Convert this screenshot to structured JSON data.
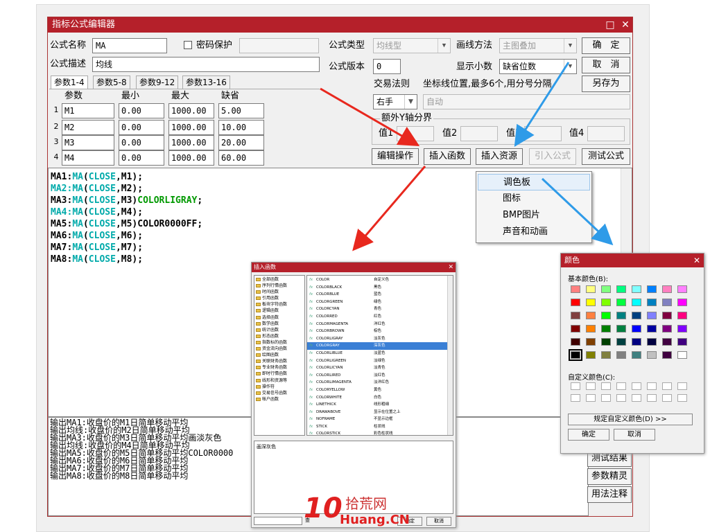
{
  "window": {
    "title": "指标公式编辑器",
    "restore_glyph": "□",
    "close_glyph": "✕"
  },
  "form": {
    "name_label": "公式名称",
    "name_value": "MA",
    "password_label": "密码保护",
    "desc_label": "公式描述",
    "desc_value": "均线",
    "type_label": "公式类型",
    "type_value": "均线型",
    "draw_label": "画线方法",
    "draw_value": "主图叠加",
    "version_label": "公式版本",
    "version_value": "0",
    "decimal_label": "显示小数",
    "decimal_value": "缺省位数",
    "trade_label": "交易法则",
    "trade_value": "右手",
    "coord_label": "坐标线位置,最多6个,用分号分隔",
    "coord_value": "自动",
    "extra_y_label": "额外Y轴分界",
    "values": [
      "值1",
      "值2",
      "值3",
      "值4"
    ]
  },
  "buttons": {
    "ok": "确　定",
    "cancel": "取　消",
    "save_as": "另存为",
    "edit": "编辑操作",
    "insert_func": "插入函数",
    "insert_res": "插入资源",
    "import": "引入公式",
    "test": "测试公式",
    "test_result": "测试结果",
    "param_wizard": "参数精灵",
    "usage_note": "用法注释"
  },
  "tabs": [
    "参数1-4",
    "参数5-8",
    "参数9-12",
    "参数13-16"
  ],
  "params": {
    "headers": [
      "参数",
      "最小",
      "最大",
      "缺省"
    ],
    "rows": [
      {
        "no": "1",
        "name": "M1",
        "min": "0.00",
        "max": "1000.00",
        "def": "5.00"
      },
      {
        "no": "2",
        "name": "M2",
        "min": "0.00",
        "max": "1000.00",
        "def": "10.00"
      },
      {
        "no": "3",
        "name": "M3",
        "min": "0.00",
        "max": "1000.00",
        "def": "20.00"
      },
      {
        "no": "4",
        "name": "M4",
        "min": "0.00",
        "max": "1000.00",
        "def": "60.00"
      }
    ]
  },
  "code_lines": [
    [
      {
        "t": "MA1:",
        "c": "black"
      },
      {
        "t": "MA",
        "c": "cyan"
      },
      {
        "t": "(",
        "c": "black"
      },
      {
        "t": "CLOSE",
        "c": "cyan"
      },
      {
        "t": ",M1);",
        "c": "black"
      }
    ],
    [
      {
        "t": "MA2:",
        "c": "cyan"
      },
      {
        "t": "MA",
        "c": "cyan"
      },
      {
        "t": "(",
        "c": "black"
      },
      {
        "t": "CLOSE",
        "c": "cyan"
      },
      {
        "t": ",M2);",
        "c": "black"
      }
    ],
    [
      {
        "t": "MA3:",
        "c": "black"
      },
      {
        "t": "MA",
        "c": "cyan"
      },
      {
        "t": "(",
        "c": "black"
      },
      {
        "t": "CLOSE",
        "c": "cyan"
      },
      {
        "t": ",M3)",
        "c": "black"
      },
      {
        "t": "COLORLIGRAY",
        "c": "green"
      },
      {
        "t": ";",
        "c": "black"
      }
    ],
    [
      {
        "t": "MA4:",
        "c": "cyan"
      },
      {
        "t": "MA",
        "c": "cyan"
      },
      {
        "t": "(",
        "c": "black"
      },
      {
        "t": "CLOSE",
        "c": "cyan"
      },
      {
        "t": ",M4);",
        "c": "black"
      }
    ],
    [
      {
        "t": "MA5:",
        "c": "black"
      },
      {
        "t": "MA",
        "c": "cyan"
      },
      {
        "t": "(",
        "c": "black"
      },
      {
        "t": "CLOSE",
        "c": "cyan"
      },
      {
        "t": ",M5)COLOR0000FF;",
        "c": "black"
      }
    ],
    [
      {
        "t": "MA6:",
        "c": "black"
      },
      {
        "t": "MA",
        "c": "cyan"
      },
      {
        "t": "(",
        "c": "black"
      },
      {
        "t": "CLOSE",
        "c": "cyan"
      },
      {
        "t": ",M6);",
        "c": "black"
      }
    ],
    [
      {
        "t": "MA7:",
        "c": "black"
      },
      {
        "t": "MA",
        "c": "cyan"
      },
      {
        "t": "(",
        "c": "black"
      },
      {
        "t": "CLOSE",
        "c": "cyan"
      },
      {
        "t": ",M7);",
        "c": "black"
      }
    ],
    [
      {
        "t": "MA8:",
        "c": "black"
      },
      {
        "t": "MA",
        "c": "cyan"
      },
      {
        "t": "(",
        "c": "black"
      },
      {
        "t": "CLOSE",
        "c": "cyan"
      },
      {
        "t": ",M8);",
        "c": "black"
      }
    ]
  ],
  "output_lines": [
    "输出MA1:收盘价的M1日简单移动平均",
    "输出均线:收盘价的M2日简单移动平均",
    "输出MA3:收盘价的M3日简单移动平均画淡灰色",
    "输出均线:收盘价的M4日简单移动平均",
    "输出MA5:收盘价的M5日简单移动平均COLOR0000",
    "输出MA6:收盘价的M6日简单移动平均",
    "输出MA7:收盘价的M7日简单移动平均",
    "输出MA8:收盘价的M8日简单移动平均"
  ],
  "resource_menu": [
    "调色板",
    "图标",
    "BMP图片",
    "声音和动画"
  ],
  "insert_dialog": {
    "title": "插入函数",
    "categories": [
      "全部函数",
      "序列行情函数",
      "时间函数",
      "引用函数",
      "板块字符函数",
      "逻辑函数",
      "选择函数",
      "数学函数",
      "统计函数",
      "形态函数",
      "指数标的函数",
      "资金流向函数",
      "绘图函数",
      "关联财务函数",
      "专业财务函数",
      "即时行情函数",
      "线形和资源等",
      "操作符",
      "交易信号函数",
      "帐户函数"
    ],
    "functions": [
      {
        "code": "COLOR",
        "name": "自定义色"
      },
      {
        "code": "COLORBLACK",
        "name": "黑色"
      },
      {
        "code": "COLORBLUE",
        "name": "蓝色"
      },
      {
        "code": "COLORGREEN",
        "name": "绿色"
      },
      {
        "code": "COLORCYAN",
        "name": "青色"
      },
      {
        "code": "COLORRED",
        "name": "红色"
      },
      {
        "code": "COLORMAGENTA",
        "name": "洋红色"
      },
      {
        "code": "COLORBROWN",
        "name": "棕色"
      },
      {
        "code": "COLORLIGRAY",
        "name": "淡灰色"
      },
      {
        "code": "COLORGRAY",
        "name": "深灰色"
      },
      {
        "code": "COLORLIBLUE",
        "name": "淡蓝色"
      },
      {
        "code": "COLORLIGREEN",
        "name": "淡绿色"
      },
      {
        "code": "COLORLICYAN",
        "name": "淡青色"
      },
      {
        "code": "COLORLIRED",
        "name": "淡红色"
      },
      {
        "code": "COLORLIMAGENTA",
        "name": "淡洋红色"
      },
      {
        "code": "COLORYELLOW",
        "name": "黄色"
      },
      {
        "code": "COLORWHITE",
        "name": "白色"
      },
      {
        "code": "LINETHICK",
        "name": "线形粗细"
      },
      {
        "code": "DRAWABOVE",
        "name": "显示在位置之上"
      },
      {
        "code": "NOFRAME",
        "name": "不显示边框"
      },
      {
        "code": "STICK",
        "name": "柱状线"
      },
      {
        "code": "COLORSTICK",
        "name": "彩色柱状线"
      }
    ],
    "selected_index": 9,
    "fx_label": "fx",
    "description": "画深灰色",
    "search_label": "查",
    "ok": "确定",
    "cancel": "取消"
  },
  "color_dialog": {
    "title": "颜色",
    "basic_label": "基本颜色(B):",
    "custom_label": "自定义颜色(C):",
    "define_button": "规定自定义颜色(D) >>",
    "ok": "确定",
    "cancel": "取消",
    "basic_colors": [
      "#ff8080",
      "#ffff80",
      "#80ff80",
      "#00ff80",
      "#80ffff",
      "#0080ff",
      "#ff80c0",
      "#ff80ff",
      "#ff0000",
      "#ffff00",
      "#80ff00",
      "#00ff40",
      "#00ffff",
      "#0080c0",
      "#8080c0",
      "#ff00ff",
      "#804040",
      "#ff8040",
      "#00ff00",
      "#008080",
      "#004080",
      "#8080ff",
      "#800040",
      "#ff0080",
      "#800000",
      "#ff8000",
      "#008000",
      "#008040",
      "#0000ff",
      "#0000a0",
      "#800080",
      "#8000ff",
      "#400000",
      "#804000",
      "#004000",
      "#004040",
      "#000080",
      "#000040",
      "#400040",
      "#400080",
      "#000000",
      "#808000",
      "#808040",
      "#808080",
      "#408080",
      "#c0c0c0",
      "#400040",
      "#ffffff"
    ],
    "selected_index": 40
  },
  "watermark": {
    "number": "10",
    "site": "拾荒网",
    "domain": "Huang.CN"
  },
  "colors": {
    "titlebar": "#b5202a",
    "arrow_red": "#e8281e",
    "arrow_blue": "#2f9be8"
  }
}
